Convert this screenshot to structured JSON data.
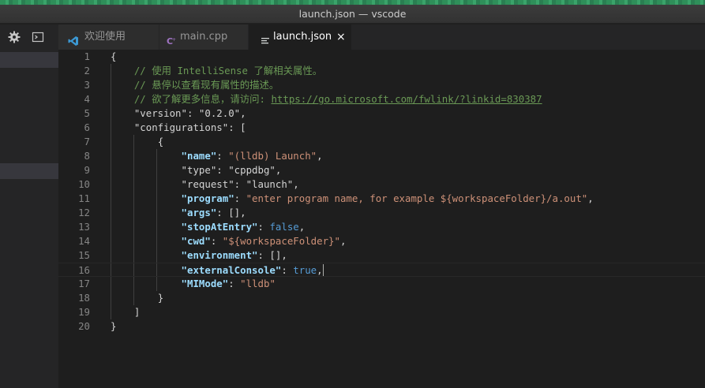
{
  "window": {
    "title": "launch.json — vscode"
  },
  "activity_icons": [
    {
      "name": "gear-icon"
    },
    {
      "name": "terminal-icon"
    }
  ],
  "tabs": [
    {
      "label": "欢迎使用",
      "icon": "vscode-logo-icon",
      "icon_color": "#3c99d4",
      "active": false
    },
    {
      "label": "main.cpp",
      "icon": "cpp-file-icon",
      "icon_color": "#a074c4",
      "active": false
    },
    {
      "label": "launch.json",
      "icon": "json-file-icon",
      "icon_color": "#d4d7d6",
      "active": true,
      "close": "×"
    }
  ],
  "colors": {
    "comment": "#6a9955",
    "key": "#9cdcfe",
    "string": "#ce9178",
    "boolean": "#569cd6",
    "punctuation": "#d4d4d4",
    "line_number": "#858585",
    "background": "#1e1e1e"
  },
  "editor": {
    "cursor_line": 16,
    "lines": [
      {
        "n": "1",
        "tokens": [
          {
            "t": "{",
            "c": "punc"
          }
        ]
      },
      {
        "n": "2",
        "tokens": [
          {
            "t": "    ",
            "c": "plain"
          },
          {
            "t": "// 使用 IntelliSense 了解相关属性。",
            "c": "comment"
          }
        ]
      },
      {
        "n": "3",
        "tokens": [
          {
            "t": "    ",
            "c": "plain"
          },
          {
            "t": "// 悬停以查看现有属性的描述。",
            "c": "comment"
          }
        ]
      },
      {
        "n": "4",
        "tokens": [
          {
            "t": "    ",
            "c": "plain"
          },
          {
            "t": "// 欲了解更多信息，请访问: ",
            "c": "comment"
          },
          {
            "t": "https://go.microsoft.com/fwlink/?linkid=830387",
            "c": "link"
          }
        ]
      },
      {
        "n": "5",
        "tokens": [
          {
            "t": "    ",
            "c": "plain"
          },
          {
            "t": "\"version\"",
            "c": "plain"
          },
          {
            "t": ": ",
            "c": "punc"
          },
          {
            "t": "\"0.2.0\"",
            "c": "plain"
          },
          {
            "t": ",",
            "c": "punc"
          }
        ]
      },
      {
        "n": "6",
        "tokens": [
          {
            "t": "    ",
            "c": "plain"
          },
          {
            "t": "\"configurations\"",
            "c": "plain"
          },
          {
            "t": ": [",
            "c": "punc"
          }
        ]
      },
      {
        "n": "7",
        "tokens": [
          {
            "t": "        ",
            "c": "plain"
          },
          {
            "t": "{",
            "c": "punc"
          }
        ]
      },
      {
        "n": "8",
        "tokens": [
          {
            "t": "            ",
            "c": "plain"
          },
          {
            "t": "\"name\"",
            "c": "key-b"
          },
          {
            "t": ": ",
            "c": "punc"
          },
          {
            "t": "\"(lldb) Launch\"",
            "c": "str"
          },
          {
            "t": ",",
            "c": "punc"
          }
        ]
      },
      {
        "n": "9",
        "tokens": [
          {
            "t": "            ",
            "c": "plain"
          },
          {
            "t": "\"type\"",
            "c": "plain"
          },
          {
            "t": ": ",
            "c": "punc"
          },
          {
            "t": "\"cppdbg\"",
            "c": "plain"
          },
          {
            "t": ",",
            "c": "punc"
          }
        ]
      },
      {
        "n": "10",
        "tokens": [
          {
            "t": "            ",
            "c": "plain"
          },
          {
            "t": "\"request\"",
            "c": "plain"
          },
          {
            "t": ": ",
            "c": "punc"
          },
          {
            "t": "\"launch\"",
            "c": "plain"
          },
          {
            "t": ",",
            "c": "punc"
          }
        ]
      },
      {
        "n": "11",
        "tokens": [
          {
            "t": "            ",
            "c": "plain"
          },
          {
            "t": "\"program\"",
            "c": "key-b"
          },
          {
            "t": ": ",
            "c": "punc"
          },
          {
            "t": "\"enter program name, for example ${workspaceFolder}/a.out\"",
            "c": "str"
          },
          {
            "t": ",",
            "c": "punc"
          }
        ]
      },
      {
        "n": "12",
        "tokens": [
          {
            "t": "            ",
            "c": "plain"
          },
          {
            "t": "\"args\"",
            "c": "key-b"
          },
          {
            "t": ": [],",
            "c": "punc"
          }
        ]
      },
      {
        "n": "13",
        "tokens": [
          {
            "t": "            ",
            "c": "plain"
          },
          {
            "t": "\"stopAtEntry\"",
            "c": "key-b"
          },
          {
            "t": ": ",
            "c": "punc"
          },
          {
            "t": "false",
            "c": "bool"
          },
          {
            "t": ",",
            "c": "punc"
          }
        ]
      },
      {
        "n": "14",
        "tokens": [
          {
            "t": "            ",
            "c": "plain"
          },
          {
            "t": "\"cwd\"",
            "c": "key-b"
          },
          {
            "t": ": ",
            "c": "punc"
          },
          {
            "t": "\"${workspaceFolder}\"",
            "c": "str"
          },
          {
            "t": ",",
            "c": "punc"
          }
        ]
      },
      {
        "n": "15",
        "tokens": [
          {
            "t": "            ",
            "c": "plain"
          },
          {
            "t": "\"environment\"",
            "c": "key-b"
          },
          {
            "t": ": [],",
            "c": "punc"
          }
        ]
      },
      {
        "n": "16",
        "tokens": [
          {
            "t": "            ",
            "c": "plain"
          },
          {
            "t": "\"externalConsole\"",
            "c": "key-b"
          },
          {
            "t": ": ",
            "c": "punc"
          },
          {
            "t": "true",
            "c": "bool"
          },
          {
            "t": ",",
            "c": "punc"
          }
        ]
      },
      {
        "n": "17",
        "tokens": [
          {
            "t": "            ",
            "c": "plain"
          },
          {
            "t": "\"MIMode\"",
            "c": "key-b"
          },
          {
            "t": ": ",
            "c": "punc"
          },
          {
            "t": "\"lldb\"",
            "c": "str"
          }
        ]
      },
      {
        "n": "18",
        "tokens": [
          {
            "t": "        ",
            "c": "plain"
          },
          {
            "t": "}",
            "c": "punc"
          }
        ]
      },
      {
        "n": "19",
        "tokens": [
          {
            "t": "    ",
            "c": "plain"
          },
          {
            "t": "]",
            "c": "punc"
          }
        ]
      },
      {
        "n": "20",
        "tokens": [
          {
            "t": "}",
            "c": "punc"
          }
        ]
      }
    ]
  }
}
